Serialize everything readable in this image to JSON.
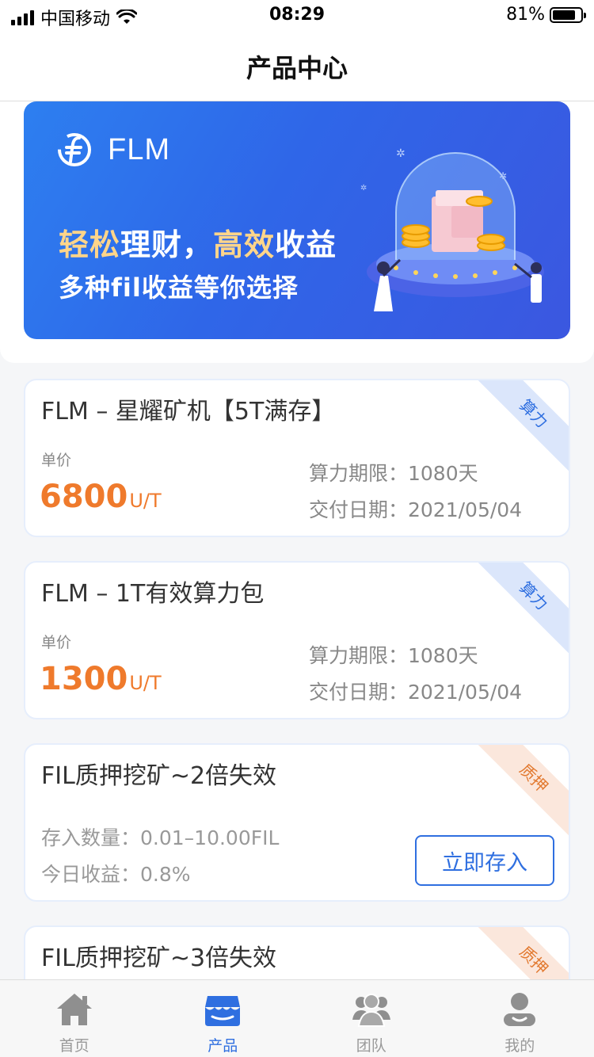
{
  "status_bar": {
    "carrier": "中国移动",
    "time": "08:29",
    "battery": "81%"
  },
  "header": {
    "title": "产品中心"
  },
  "banner": {
    "brand": "FLM",
    "slogan_part1": "轻松",
    "slogan_part2": "理财，",
    "slogan_part3": "高效",
    "slogan_part4": "收益",
    "slogan_line2": "多种fil收益等你选择"
  },
  "products": [
    {
      "title": "FLM – 星耀矿机【5T满存】",
      "tag": "算力",
      "price_label": "单价",
      "price": "6800",
      "unit": "U/T",
      "period": "算力期限：1080天",
      "delivery": "交付日期：2021/05/04"
    },
    {
      "title": "FLM – 1T有效算力包",
      "tag": "算力",
      "price_label": "单价",
      "price": "1300",
      "unit": "U/T",
      "period": "算力期限：1080天",
      "delivery": "交付日期：2021/05/04"
    }
  ],
  "pledges": [
    {
      "title": "FIL质押挖矿~2倍失效",
      "tag": "质押",
      "amount": "存入数量：0.01–10.00FIL",
      "yield": "今日收益：0.8%",
      "button": "立即存入"
    },
    {
      "title": "FIL质押挖矿~3倍失效",
      "tag": "质押"
    }
  ],
  "tabs": [
    {
      "label": "首页",
      "icon": "home-icon"
    },
    {
      "label": "产品",
      "icon": "product-icon",
      "active": true
    },
    {
      "label": "团队",
      "icon": "team-icon"
    },
    {
      "label": "我的",
      "icon": "profile-icon"
    }
  ],
  "colors": {
    "accent": "#2f6fe0",
    "price": "#ef7a2c",
    "tag_blue_bg": "#dbe6fb",
    "tag_orange_bg": "#fbe7dc"
  }
}
